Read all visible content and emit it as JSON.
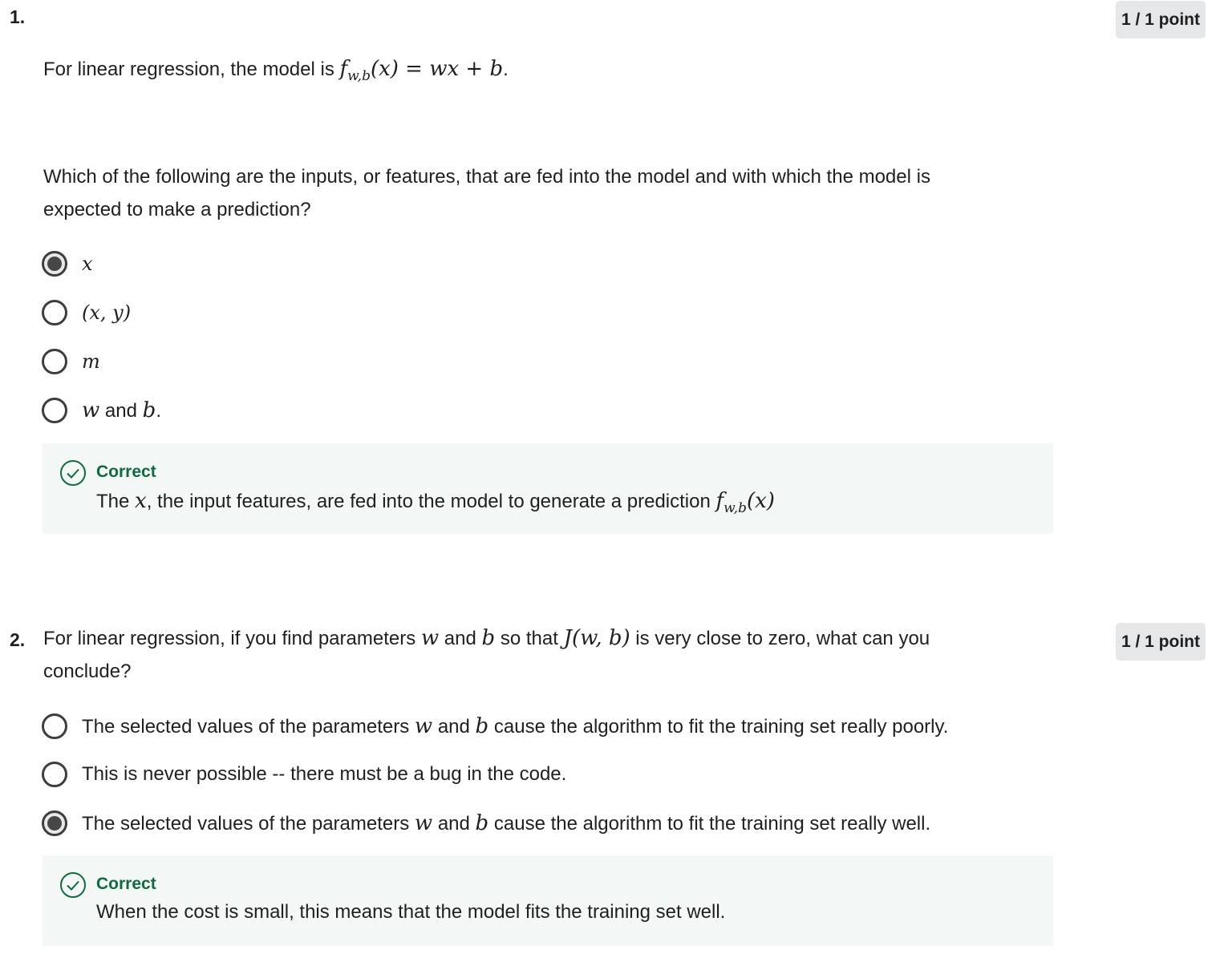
{
  "q1": {
    "number": "1.",
    "points": "1 / 1 point",
    "prompt": {
      "pre": "For linear regression, the model is ",
      "f": "f",
      "sub": "w,b",
      "eq": "(x) = wx + b",
      "post": "."
    },
    "question_line1": "Which of the following are the inputs, or features, that are fed into the model and with which the model is",
    "question_line2": "expected to make a prediction?",
    "options": [
      {
        "math": "x",
        "selected": true
      },
      {
        "math": "(x, y)",
        "selected": false
      },
      {
        "math": "m",
        "selected": false
      },
      {
        "w": "w",
        "and": " and ",
        "b": "b",
        "dot": ".",
        "selected": false
      }
    ],
    "feedback": {
      "icon": "check-circle-icon",
      "title": "Correct",
      "pre": "The ",
      "x": "x",
      "mid": ", the input features, are fed into the model to generate a prediction ",
      "f": "f",
      "sub": "w,b",
      "arg": "(x)"
    }
  },
  "q2": {
    "number": "2.",
    "points": "1 / 1 point",
    "prompt": {
      "t1": "For linear regression, if you find parameters ",
      "w": "w",
      "t2": " and ",
      "b": "b",
      "t3": " so that ",
      "J": "J(w, b)",
      "t4": " is very close to zero, what can you",
      "line2": "conclude?"
    },
    "options": [
      {
        "t1": "The selected values of the parameters ",
        "w": "w",
        "t2": " and ",
        "b": "b",
        "t3": " cause the algorithm to fit the training set really poorly.",
        "selected": false
      },
      {
        "text": "This is never possible -- there must be a bug in the code.",
        "selected": false
      },
      {
        "t1": "The selected values of the parameters ",
        "w": "w",
        "t2": " and ",
        "b": "b",
        "t3": " cause the algorithm to fit the training set really well.",
        "selected": true
      }
    ],
    "feedback": {
      "icon": "check-circle-icon",
      "title": "Correct",
      "text": "When the cost is small, this means that the model fits the training set well."
    }
  },
  "colors": {
    "correct_green": "#0f6b3d",
    "feedback_bg": "#f3f8f6",
    "badge_bg": "#e6e7e8"
  }
}
